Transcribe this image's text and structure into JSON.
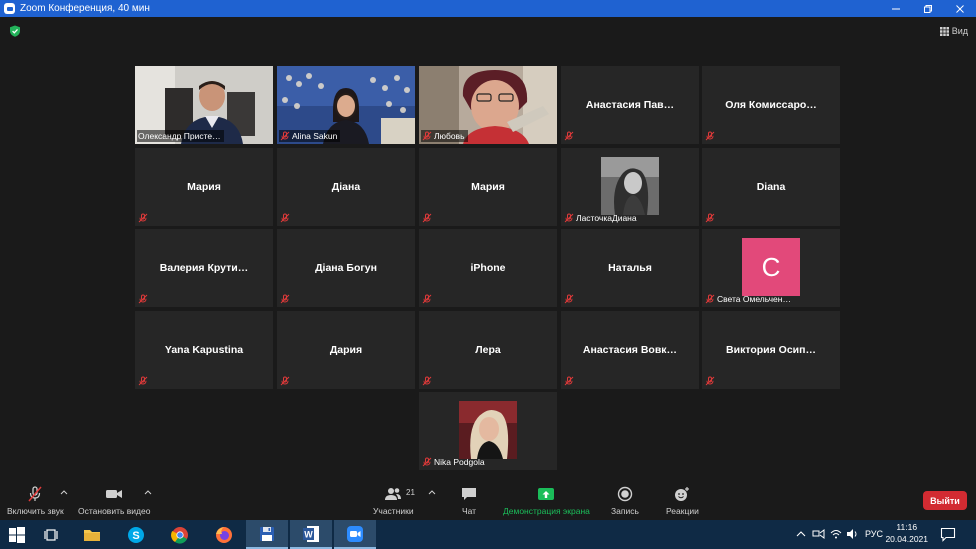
{
  "window": {
    "title": "Zoom Конференция, 40 мин"
  },
  "view": {
    "label": "Вид"
  },
  "participants_grid": [
    {
      "name": "Олександр Присте…",
      "kind": "video",
      "label_only": true,
      "active": true,
      "muted": false
    },
    {
      "name": "Alina Sakun",
      "kind": "video",
      "label_only": true,
      "muted": true
    },
    {
      "name": "Любовь",
      "kind": "video",
      "label_only": true,
      "muted": true
    },
    {
      "name": "Анастасия Пав…",
      "kind": "name",
      "muted": true
    },
    {
      "name": "Оля Комиссаро…",
      "kind": "name",
      "muted": true
    },
    {
      "name": "Мария",
      "kind": "name",
      "muted": true
    },
    {
      "name": "Діана",
      "kind": "name",
      "muted": true
    },
    {
      "name": "Мария",
      "kind": "name",
      "muted": true
    },
    {
      "name": "ЛасточкаДиана",
      "kind": "photo",
      "muted": true
    },
    {
      "name": "Diana",
      "kind": "name",
      "muted": true
    },
    {
      "name": "Валерия Крути…",
      "kind": "name",
      "muted": true
    },
    {
      "name": "Діана Богун",
      "kind": "name",
      "muted": true
    },
    {
      "name": "iPhone",
      "kind": "name",
      "muted": true
    },
    {
      "name": "Наталья",
      "kind": "name",
      "muted": true
    },
    {
      "name": "Света Омельчен…",
      "kind": "letter",
      "letter": "С",
      "muted": true
    },
    {
      "name": "Yana Kapustina",
      "kind": "name",
      "muted": true
    },
    {
      "name": "Дария",
      "kind": "name",
      "muted": true
    },
    {
      "name": "Лера",
      "kind": "name",
      "muted": true
    },
    {
      "name": "Анастасия Вовк…",
      "kind": "name",
      "muted": true
    },
    {
      "name": "Виктория Осип…",
      "kind": "name",
      "muted": true
    },
    {
      "name": "Nika Podgola",
      "kind": "photo",
      "muted": true
    }
  ],
  "toolbar": {
    "unmute": "Включить звук",
    "stop_video": "Остановить видео",
    "participants": "Участники",
    "participants_count": "21",
    "chat": "Чат",
    "share": "Демонстрация экрана",
    "record": "Запись",
    "reactions": "Реакции",
    "leave": "Выйти"
  },
  "taskbar": {
    "lang": "РУС",
    "time": "11:16",
    "date": "20.04.2021"
  },
  "colors": {
    "titlebar": "#1f62d1",
    "share_green": "#1bbd5a",
    "leave_red": "#d22b32",
    "active_border": "#e4e45a",
    "letter_avatar": "#e2497a"
  }
}
